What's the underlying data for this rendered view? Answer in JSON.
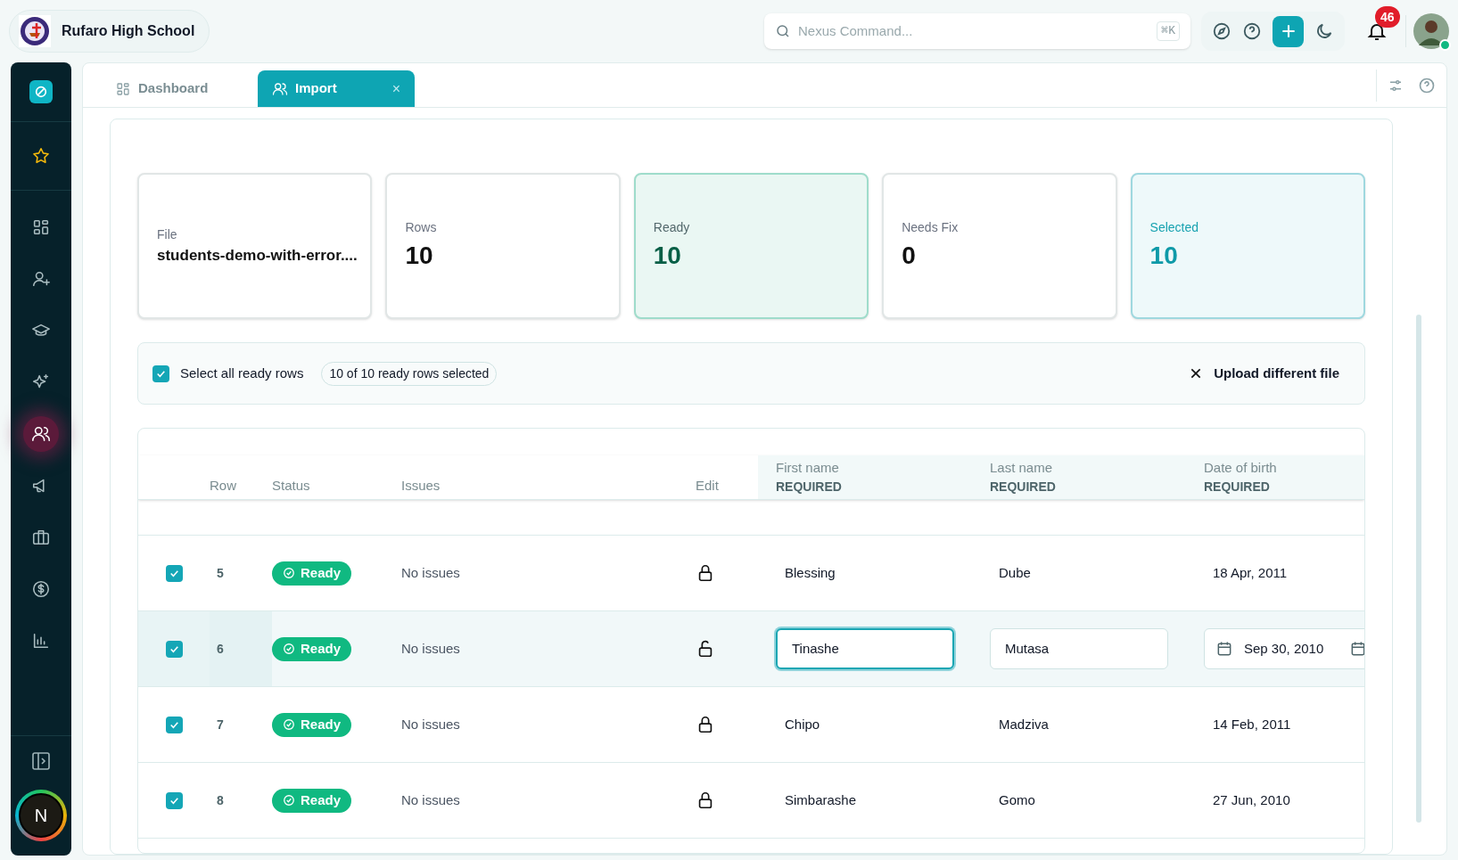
{
  "school": {
    "name": "Rufaro High School"
  },
  "search": {
    "placeholder": "Nexus Command...",
    "shortcut": "⌘K"
  },
  "notifications": {
    "count": "46"
  },
  "user": {
    "online": true
  },
  "sidebar": {
    "items": [
      {
        "kind": "star",
        "selected": false
      },
      {
        "kind": "grid",
        "selected": false
      },
      {
        "kind": "user-plus",
        "selected": false
      },
      {
        "kind": "cap",
        "selected": false
      },
      {
        "kind": "sparkles",
        "selected": false
      },
      {
        "kind": "users",
        "selected": true
      },
      {
        "kind": "megaphone",
        "selected": false
      },
      {
        "kind": "briefcase",
        "selected": false
      },
      {
        "kind": "dollar",
        "selected": false
      },
      {
        "kind": "chart",
        "selected": false
      }
    ],
    "profile_initial": "N"
  },
  "tabs": [
    {
      "label": "Dashboard",
      "kind": "grid",
      "selected": false
    },
    {
      "label": "Import",
      "kind": "users",
      "selected": true,
      "close": "×"
    }
  ],
  "stats": [
    {
      "label": "File",
      "value": "students-demo-with-error....",
      "kind": "file"
    },
    {
      "label": "Rows",
      "value": "10",
      "kind": "plain"
    },
    {
      "label": "Ready",
      "value": "10",
      "kind": "ready"
    },
    {
      "label": "Needs Fix",
      "value": "0",
      "kind": "plain"
    },
    {
      "label": "Selected",
      "value": "10",
      "kind": "selected"
    }
  ],
  "selection": {
    "checked": true,
    "label": "Select all ready rows",
    "summary": "10 of 10 ready rows selected",
    "upload_label": "Upload different file"
  },
  "table": {
    "columns": [
      {
        "label": "Row"
      },
      {
        "label": "Status"
      },
      {
        "label": "Issues"
      },
      {
        "label": "Edit"
      },
      {
        "label": "First name",
        "note": "REQUIRED"
      },
      {
        "label": "Last name",
        "note": "REQUIRED"
      },
      {
        "label": "Date of birth",
        "note": "REQUIRED"
      }
    ],
    "rows": [
      {
        "checked": true,
        "row": "5",
        "status": "Ready",
        "issues": "No issues",
        "editing": false,
        "first": "Blessing",
        "last": "Dube",
        "dob": "18 Apr, 2011"
      },
      {
        "checked": true,
        "row": "6",
        "status": "Ready",
        "issues": "No issues",
        "editing": true,
        "first": "Tinashe",
        "last": "Mutasa",
        "dob": "Sep 30, 2010"
      },
      {
        "checked": true,
        "row": "7",
        "status": "Ready",
        "issues": "No issues",
        "editing": false,
        "first": "Chipo",
        "last": "Madziva",
        "dob": "14 Feb, 2011"
      },
      {
        "checked": true,
        "row": "8",
        "status": "Ready",
        "issues": "No issues",
        "editing": false,
        "first": "Simbarashe",
        "last": "Gomo",
        "dob": "27 Jun, 2010"
      }
    ]
  }
}
